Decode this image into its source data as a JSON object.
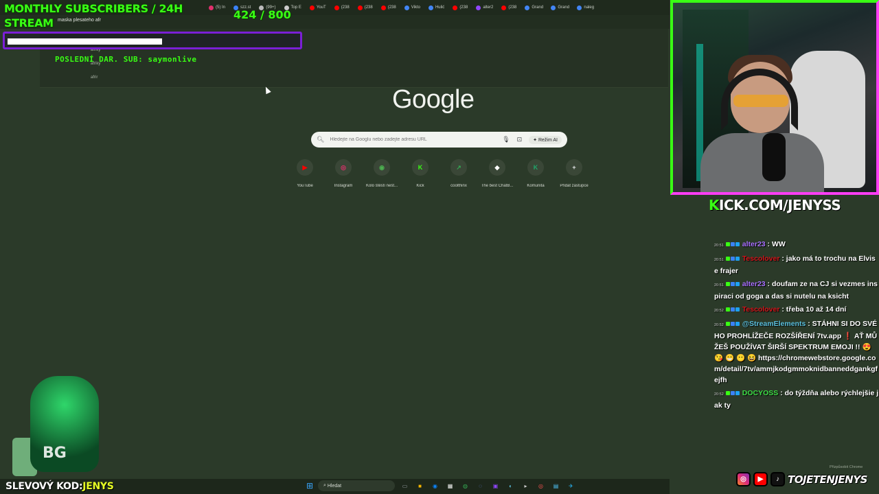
{
  "browser": {
    "tabs": [
      {
        "label": "(5) In",
        "color": "#e1306c"
      },
      {
        "label": "szz.st",
        "color": "#3b82f6"
      },
      {
        "label": "(99+)",
        "color": "#bbbbbb"
      },
      {
        "label": "Top E",
        "color": "#cccccc"
      },
      {
        "label": "YouT",
        "color": "#ff0000"
      },
      {
        "label": "(238",
        "color": "#ff0000"
      },
      {
        "label": "(238",
        "color": "#ff0000"
      },
      {
        "label": "(238",
        "color": "#ff0000"
      },
      {
        "label": "Vikto",
        "color": "#4285f4"
      },
      {
        "label": "Hulić",
        "color": "#4285f4"
      },
      {
        "label": "(238",
        "color": "#ff0000"
      },
      {
        "label": "alter2",
        "color": "#9146ff"
      },
      {
        "label": "(238",
        "color": "#ff0000"
      },
      {
        "label": "Grand",
        "color": "#4285f4"
      },
      {
        "label": "Grand",
        "color": "#4285f4"
      },
      {
        "label": "naleg",
        "color": "#4285f4"
      }
    ],
    "address_text": "maska plesateho afr",
    "suggestions": [
      "afriky",
      "afriky",
      "afrir"
    ]
  },
  "overlay": {
    "title_line1": "MONTHLY SUBSCRIBERS / 24H",
    "title_line2": "STREAM",
    "count": "424 / 800",
    "progress_fraction": 0.53,
    "last_sub": "POSLEDNÍ DAR. SUB: saymonlive"
  },
  "google": {
    "logo": "Google",
    "search_placeholder": "Hledejte na Googlu nebo zadejte adresu URL",
    "ai_mode": "Režim AI",
    "shortcuts": [
      {
        "label": "YouTube",
        "glyph": "▶",
        "color": "#ff0000"
      },
      {
        "label": "Instagram",
        "glyph": "◎",
        "color": "#e1306c"
      },
      {
        "label": "Kolo štěstí nešt...",
        "glyph": "◉",
        "color": "#4caf50"
      },
      {
        "label": "Kick",
        "glyph": "K",
        "color": "#39ff14"
      },
      {
        "label": "coolthinx",
        "glyph": "↗",
        "color": "#34a853"
      },
      {
        "label": "The best ChatB...",
        "glyph": "◆",
        "color": "#ffffff"
      },
      {
        "label": "Komunita",
        "glyph": "K",
        "color": "#1fa66b"
      },
      {
        "label": "Přidat zástupce",
        "glyph": "+",
        "color": "#e8eaed"
      }
    ]
  },
  "stream": {
    "kick_url_k": "K",
    "kick_url_rest": "ICK.COM/JENYSS",
    "promo_label": "SLEVOVÝ KOD:",
    "promo_code": "JENYS",
    "avatar_brand": "BG",
    "social_handle": "TOJETENJENYS",
    "customize_chrome": "Přizpůsobit Chrome"
  },
  "chat": [
    {
      "time": "20:51",
      "user": "alter23",
      "color": "#a970ff",
      "text": "WW"
    },
    {
      "time": "20:51",
      "user": "Tescolover",
      "color": "#d4151b",
      "text": "jako má to trochu na Elvise frajer"
    },
    {
      "time": "20:51",
      "user": "alter23",
      "color": "#a970ff",
      "text": "doufam ze na CJ si vezmes inspiraci od goga a das si nutelu na ksicht"
    },
    {
      "time": "20:52",
      "user": "Tescolover",
      "color": "#d4151b",
      "text": "třeba 10 až 14 dní"
    },
    {
      "time": "20:52",
      "user": "@StreamElements",
      "color": "#5bc0de",
      "text": "STÁHNI SI DO SVÉHO PROHLÍŽEČE ROZŠÍŘENÍ 7tv.app ❗ AŤ MŮŽEŠ POUŽÍVAT ŠIRŠÍ SPEKTRUM EMOJI !! 😍 😘 😁 😶 😆 https://chromewebstore.google.com/detail/7tv/ammjkodgmmoknidbanneddgankgfejfh"
    },
    {
      "time": "20:52",
      "user": "DOCYOSS",
      "color": "#3ddc45",
      "text": "do týždňa alebo rýchlejšie jak ty"
    }
  ],
  "taskbar": {
    "search_label": "Hledat",
    "apps": [
      {
        "glyph": "▭",
        "color": "#9aa0a6"
      },
      {
        "glyph": "■",
        "color": "#f4b400"
      },
      {
        "glyph": "◉",
        "color": "#0a84ff"
      },
      {
        "glyph": "▦",
        "color": "#eeeeee"
      },
      {
        "glyph": "◍",
        "color": "#34a853"
      },
      {
        "glyph": "◌",
        "color": "#6d8dff"
      },
      {
        "glyph": "▣",
        "color": "#9146ff"
      },
      {
        "glyph": "◐",
        "color": "#5bc0de"
      },
      {
        "glyph": "▸",
        "color": "#cccccc"
      },
      {
        "glyph": "◎",
        "color": "#ff5252"
      },
      {
        "glyph": "▤",
        "color": "#4fc3f7"
      },
      {
        "glyph": "✈",
        "color": "#29b6f6"
      }
    ]
  }
}
